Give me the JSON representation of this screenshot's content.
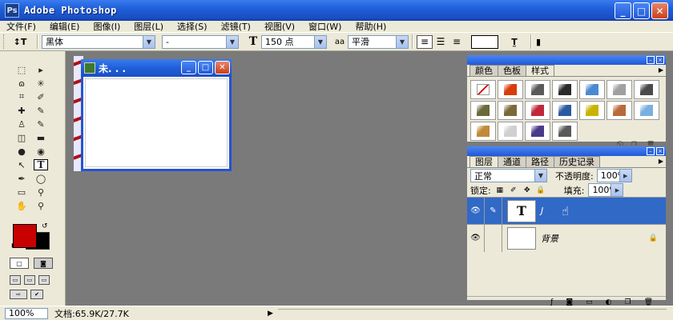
{
  "app": {
    "title": "Adobe Photoshop",
    "icon_letters": "Ps"
  },
  "window_controls": {
    "minimize": "_",
    "maximize": "□",
    "close": "✕"
  },
  "menu": {
    "items": [
      "文件(F)",
      "编辑(E)",
      "图像(I)",
      "图层(L)",
      "选择(S)",
      "滤镜(T)",
      "视图(V)",
      "窗口(W)",
      "帮助(H)"
    ]
  },
  "options_bar": {
    "orientation_icon": "↕T",
    "font_family": "黑体",
    "font_style": "-",
    "size_icon": "T",
    "font_size": "150 点",
    "aa_icon": "aa",
    "antialias": "平滑",
    "warp_icon": "T̰"
  },
  "tools": {
    "items": [
      "marquee-icon",
      "move-icon",
      "lasso-icon",
      "magic-wand-icon",
      "crop-icon",
      "slice-icon",
      "healing-icon",
      "brush-icon",
      "stamp-icon",
      "history-brush-icon",
      "eraser-icon",
      "gradient-icon",
      "blur-icon",
      "dodge-icon",
      "path-select-icon",
      "type-icon",
      "pen-icon",
      "shape-icon",
      "notes-icon",
      "eyedropper-icon",
      "hand-icon",
      "zoom-icon"
    ],
    "glyphs": [
      "⬚",
      "▸",
      "ɷ",
      "✳",
      "⌗",
      "✐",
      "✚",
      "✎",
      "♙",
      "✎",
      "◫",
      "▬",
      "●",
      "◉",
      "↖",
      "T",
      "✒",
      "◯",
      "▭",
      "⚲",
      "✋",
      "⚲"
    ],
    "active": "type-icon",
    "foreground_color": "#c80000",
    "background_color": "#000000"
  },
  "document": {
    "title": "未. . ."
  },
  "styles_panel": {
    "tabs": [
      "颜色",
      "色板",
      "样式"
    ],
    "active_tab": "样式",
    "swatch_colors": [
      "#ffffff",
      "#d83c0c",
      "#5a5a5a",
      "#2a2a2a",
      "#4a8ad0",
      "#a0a0a0",
      "#4a4a4a",
      "#6a6a3a",
      "#7a6a3a",
      "#c0283a",
      "#2a5aa0",
      "#c8b400",
      "#b86a3a",
      "#7ab0e0",
      "#c08a3a",
      "#d0d0d0",
      "#4a3a8a",
      "#5a5a5a"
    ]
  },
  "layers_panel": {
    "tabs": [
      "图层",
      "通道",
      "路径",
      "历史记录"
    ],
    "active_tab": "图层",
    "blend_mode": "正常",
    "opacity_label": "不透明度:",
    "opacity": "100%",
    "lock_label": "锁定:",
    "fill_label": "填充:",
    "fill": "100%",
    "layers": [
      {
        "name": "J",
        "thumb": "T",
        "selected": true
      },
      {
        "name": "背景",
        "thumb": "",
        "selected": false
      }
    ]
  },
  "status_bar": {
    "zoom": "100%",
    "doc_info": "文档:65.9K/27.7K"
  }
}
